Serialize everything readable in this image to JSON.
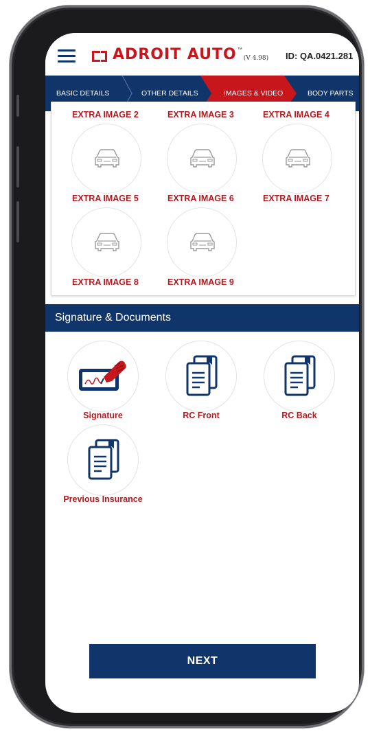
{
  "header": {
    "brand": "ADROIT AUTO",
    "trademark": "™",
    "version": "(V 4.98)",
    "id_text": "ID: QA.0421.281"
  },
  "steps": [
    {
      "label": "BASIC DETAILS",
      "active": false
    },
    {
      "label": "OTHER DETAILS",
      "active": false
    },
    {
      "label": "IMAGES & VIDEO",
      "active": true
    },
    {
      "label": "BODY PARTS",
      "active": false
    }
  ],
  "gallery": {
    "partial_labels": [
      "EXTRA IMAGE 2",
      "EXTRA IMAGE 3",
      "EXTRA IMAGE 4"
    ],
    "items": [
      {
        "label": "EXTRA IMAGE 5",
        "icon": "car-icon"
      },
      {
        "label": "EXTRA IMAGE 6",
        "icon": "car-icon"
      },
      {
        "label": "EXTRA IMAGE 7",
        "icon": "car-icon"
      },
      {
        "label": "EXTRA IMAGE 8",
        "icon": "car-icon"
      },
      {
        "label": "EXTRA IMAGE 9",
        "icon": "car-icon"
      }
    ]
  },
  "documents_section": {
    "title": "Signature & Documents",
    "items": [
      {
        "label": "Signature",
        "icon": "signature-icon"
      },
      {
        "label": "RC Front",
        "icon": "document-icon"
      },
      {
        "label": "RC Back",
        "icon": "document-icon"
      },
      {
        "label": "Previous Insurance",
        "icon": "document-icon"
      }
    ]
  },
  "next_button": "NEXT",
  "colors": {
    "primary": "#10356b",
    "accent": "#c8161d",
    "label": "#b11a1f"
  }
}
